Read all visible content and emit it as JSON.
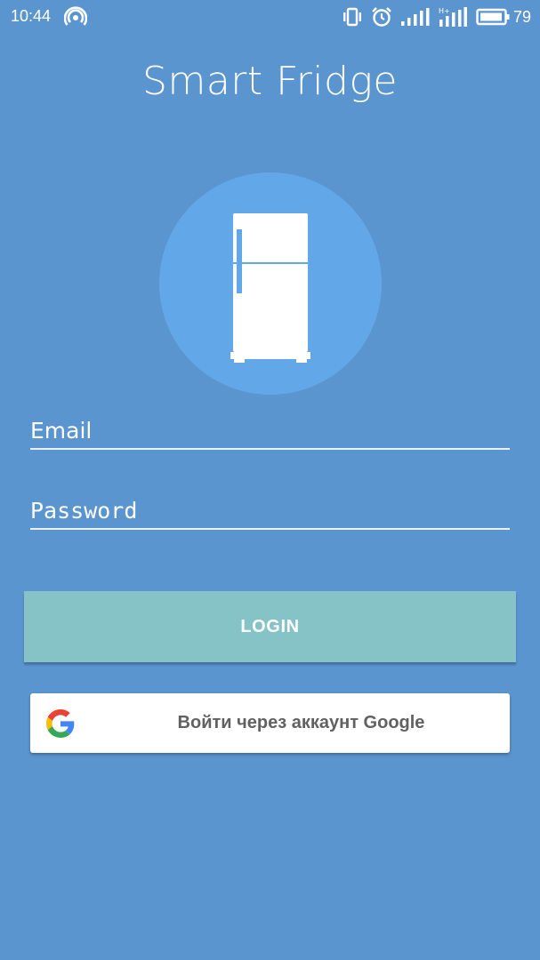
{
  "status_bar": {
    "time": "10:44",
    "battery_level": "79",
    "icons": [
      "hotspot-icon",
      "vibrate-icon",
      "alarm-icon",
      "signal-icon",
      "signal-hplus-icon",
      "battery-icon"
    ]
  },
  "app": {
    "title": "Smart Fridge",
    "logo_icon": "fridge-icon"
  },
  "form": {
    "email_placeholder": "Email",
    "email_value": "",
    "password_placeholder": "Password",
    "password_value": ""
  },
  "buttons": {
    "login_label": "LOGIN",
    "google_label": "Войти через аккаунт Google",
    "google_icon": "google-icon"
  },
  "colors": {
    "background": "#5b95cf",
    "logo_circle": "#62a8e9",
    "login_button": "#86c3c7",
    "google_button": "#ffffff"
  }
}
